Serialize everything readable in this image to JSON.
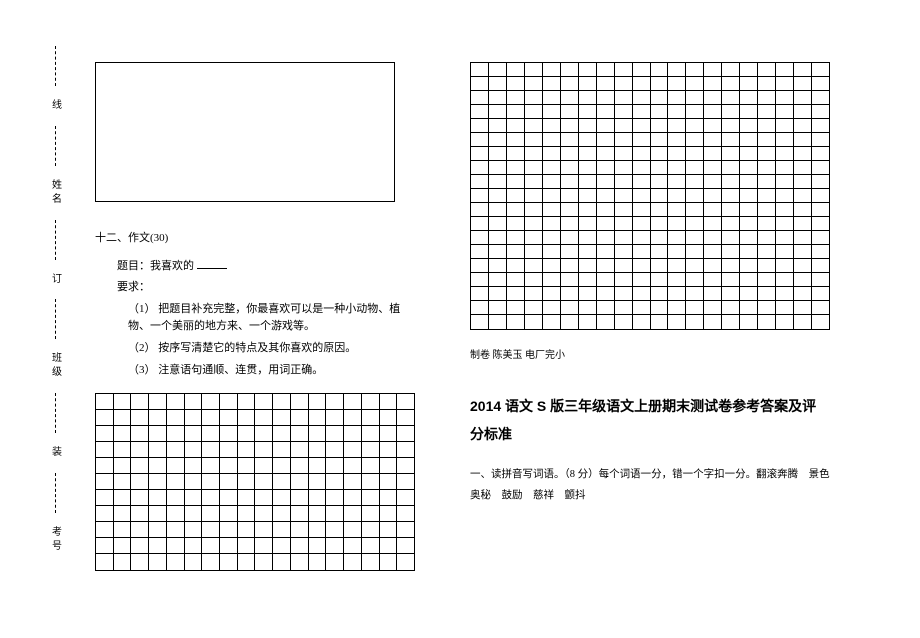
{
  "vertical_strip": {
    "label1": "考号",
    "mark1": "装",
    "label2": "班级",
    "mark2": "订",
    "label3": "姓名",
    "mark3": "线"
  },
  "left": {
    "heading": "十二、作文(30)",
    "topic_label": "题目：我喜欢的",
    "req_label": "要求：",
    "req1": "（1） 把题目补充完整，你最喜欢可以是一种小动物、植物、一个美丽的地方来、一个游戏等。",
    "req2": "（2） 按序写清楚它的特点及其你喜欢的原因。",
    "req3": "（3） 注意语句通顺、连贯，用词正确。",
    "grid": {
      "rows": 11,
      "cols": 18
    }
  },
  "right": {
    "grid": {
      "rows": 19,
      "cols": 20
    },
    "credit": "制卷 陈美玉 电厂完小",
    "answer_title": "2014 语文 S 版三年级语文上册期末测试卷参考答案及评分标准",
    "answer_q1": "一、读拼音写词语。（8 分）每个词语一分，错一个字扣一分。翻滚奔腾　景色　奥秘　鼓励　慈祥　颤抖"
  }
}
